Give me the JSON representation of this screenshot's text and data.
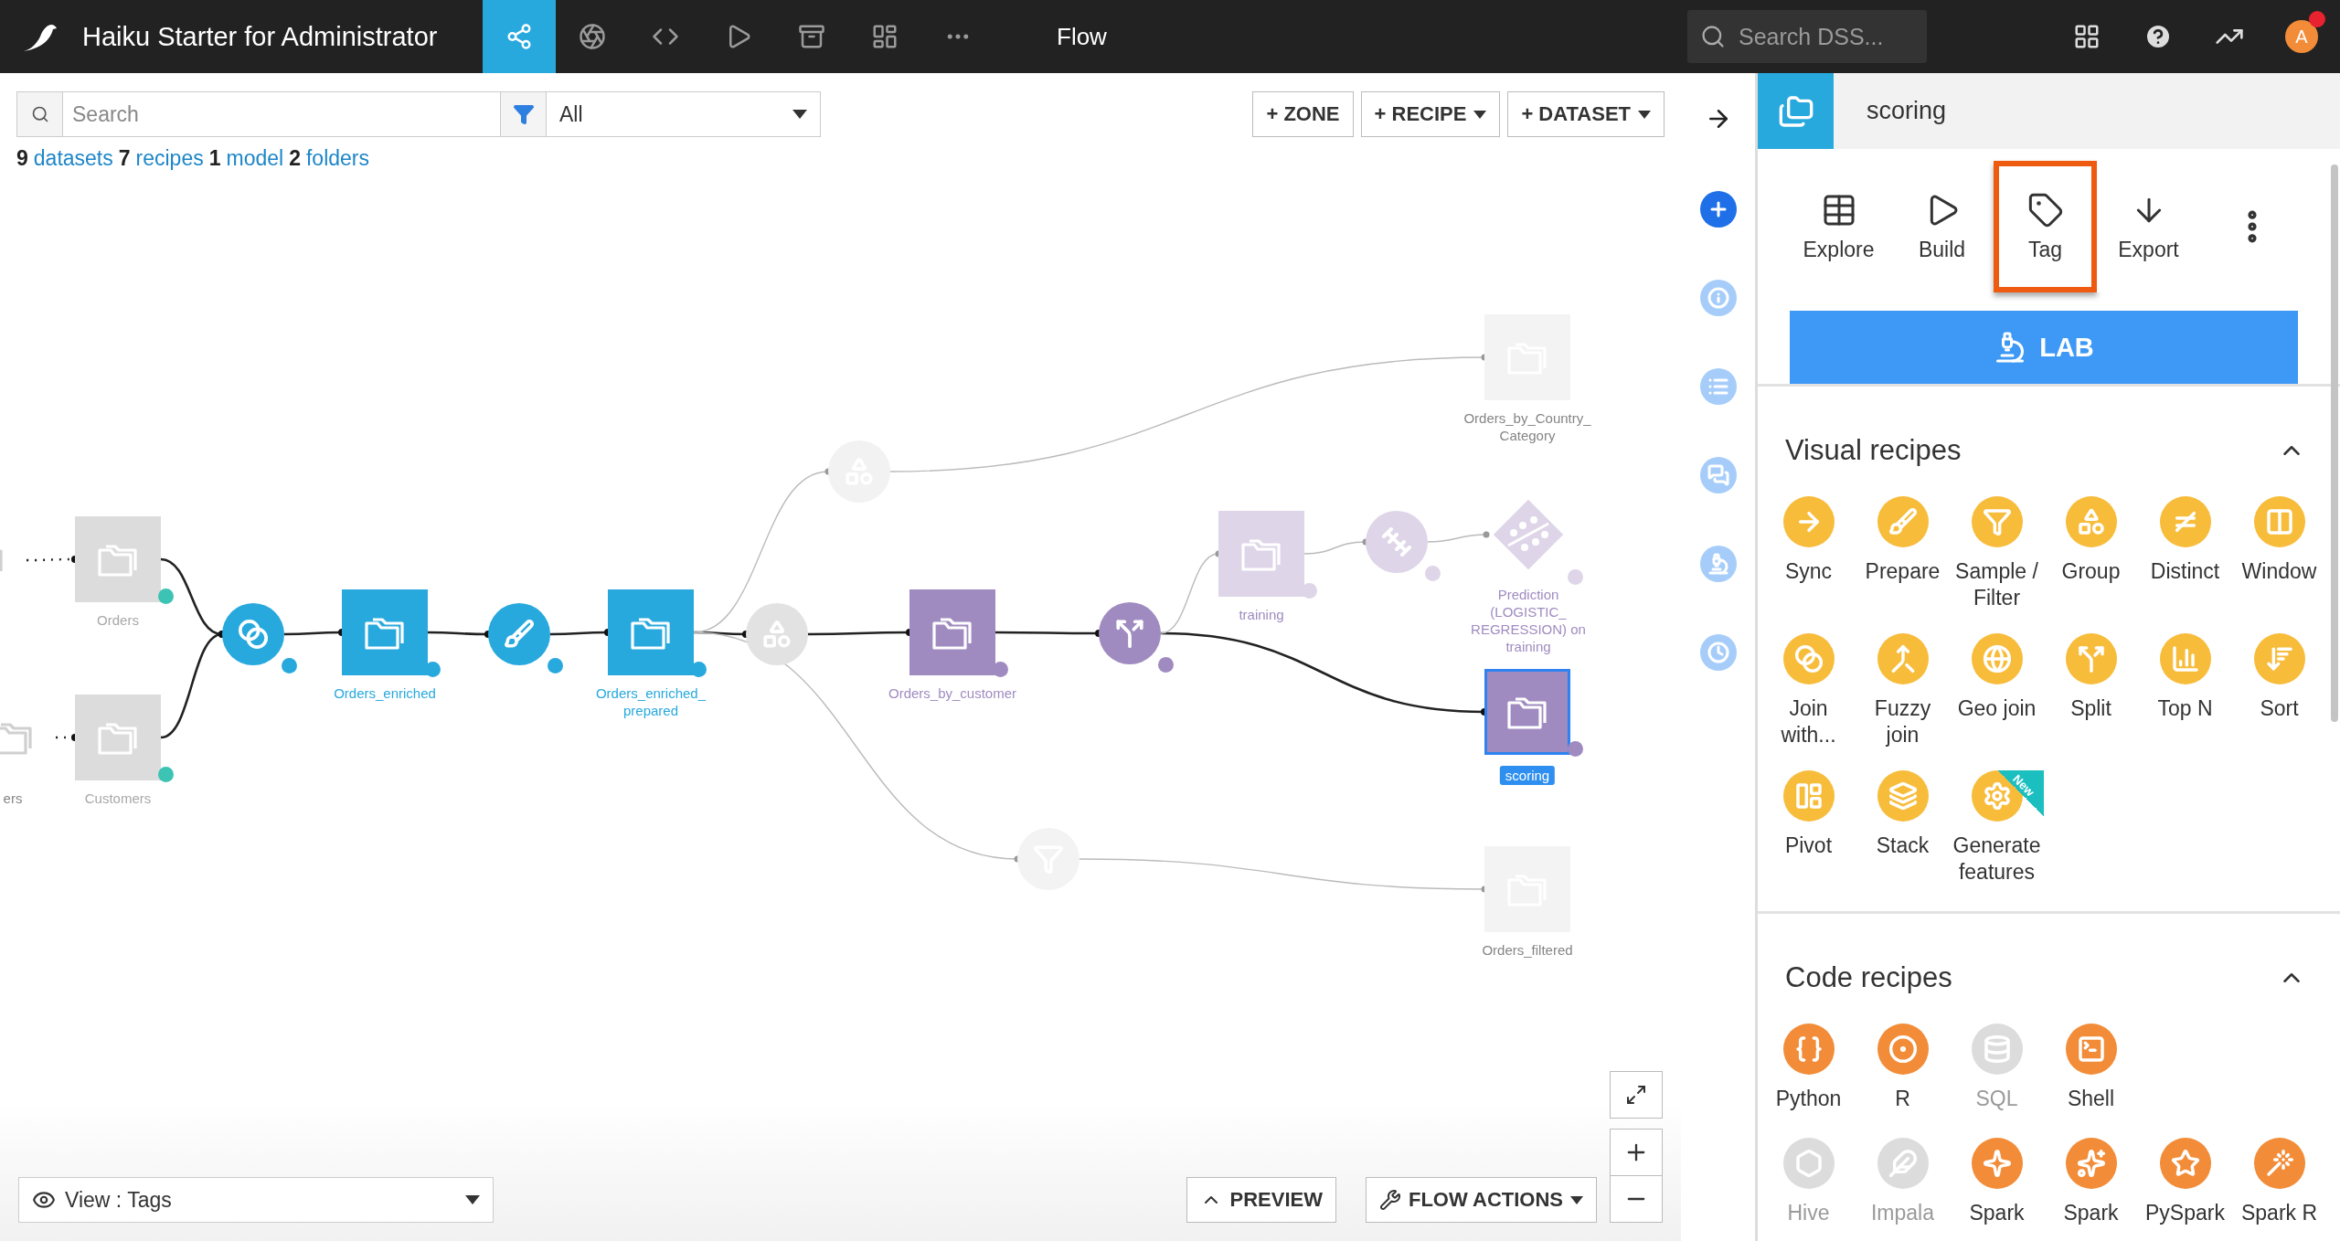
{
  "header": {
    "title": "Haiku Starter for Administrator",
    "nav": [
      {
        "selected": true
      },
      {
        "selected": false
      },
      {
        "selected": false
      },
      {
        "selected": false
      },
      {
        "selected": false
      },
      {
        "selected": false
      },
      {
        "selected": false
      }
    ],
    "section": "Flow",
    "search": {
      "placeholder": "Search DSS..."
    },
    "avatar": {
      "initial": "A",
      "notification": true
    }
  },
  "toolbar": {
    "search": {
      "placeholder": "Search"
    },
    "filter": {
      "value": "All"
    },
    "buttons": [
      {
        "label": "+ ZONE",
        "dropdown": false
      },
      {
        "label": "+ RECIPE",
        "dropdown": true
      },
      {
        "label": "+ DATASET",
        "dropdown": true
      }
    ]
  },
  "summary": [
    {
      "count": "9",
      "label": "datasets"
    },
    {
      "count": "7",
      "label": "recipes"
    },
    {
      "count": "1",
      "label": "model"
    },
    {
      "count": "2",
      "label": "folders"
    }
  ],
  "flow": {
    "nodes": [
      {
        "kind": "dataset",
        "color": "#ffffff",
        "dot": false,
        "selected": false
      },
      {
        "kind": "dataset",
        "label": "ers",
        "color": "#ffffff",
        "dot": false,
        "selected": false
      },
      {
        "kind": "dataset",
        "label": "Orders",
        "color": "#dcdcdc",
        "dot": true,
        "selected": false
      },
      {
        "kind": "dataset",
        "label": "Customers",
        "color": "#dcdcdc",
        "dot": true,
        "selected": false
      },
      {
        "kind": "join",
        "color": "#28a9dd",
        "dot": true,
        "selected": false
      },
      {
        "kind": "dataset",
        "label": "Orders_enriched",
        "color": "#28a9dd",
        "dot": true,
        "selected": false
      },
      {
        "kind": "prepare",
        "color": "#28a9dd",
        "dot": true,
        "selected": false
      },
      {
        "kind": "dataset",
        "label": "Orders_enriched_prepared",
        "color": "#28a9dd",
        "dot": true,
        "selected": false
      },
      {
        "kind": "group",
        "color": "#e2e2e2",
        "dot": false,
        "selected": false
      },
      {
        "kind": "group",
        "color": "#f2f2f2",
        "dot": false,
        "selected": false
      },
      {
        "kind": "dataset",
        "label": "Orders_by_customer",
        "color": "#a08bc0",
        "dot": true,
        "selected": false
      },
      {
        "kind": "split",
        "color": "#a08bc0",
        "dot": true,
        "selected": false
      },
      {
        "kind": "dataset",
        "label": "training",
        "color": "#ded5e8",
        "dot": true,
        "selected": false
      },
      {
        "kind": "train",
        "color": "#ded5e8",
        "dot": true,
        "selected": false
      },
      {
        "kind": "dataset",
        "label": "Orders_by_Country_Category",
        "color": "#f3f3f3",
        "dot": false,
        "selected": false
      },
      {
        "kind": "model",
        "label": "Prediction (LOGISTIC_REGRESSION) on training",
        "color": "#ded5e8",
        "dot": true,
        "selected": false
      },
      {
        "kind": "dataset",
        "label": "scoring",
        "color": "#a08bc0",
        "dot": true,
        "selected": true
      },
      {
        "kind": "filter",
        "color": "#f3f3f3",
        "dot": false,
        "selected": false
      },
      {
        "kind": "dataset",
        "label": "Orders_filtered",
        "color": "#f3f3f3",
        "dot": false,
        "selected": false
      }
    ]
  },
  "bottom": {
    "view": {
      "value": "View : Tags"
    },
    "buttons": [
      {
        "label": "PREVIEW",
        "kind": "preview"
      },
      {
        "label": "FLOW ACTIONS",
        "kind": "actions"
      }
    ]
  },
  "rail": [
    {
      "active": true
    },
    {
      "active": false
    },
    {
      "active": false
    },
    {
      "active": false
    },
    {
      "active": false
    },
    {
      "active": false
    }
  ],
  "panel": {
    "title": "scoring",
    "actions": [
      {
        "label": "Explore",
        "highlighted": false
      },
      {
        "label": "Build",
        "highlighted": false
      },
      {
        "label": "Tag",
        "highlighted": true
      },
      {
        "label": "Export",
        "highlighted": false
      }
    ],
    "lab": {
      "label": "LAB"
    },
    "sections": [
      {
        "title": "Visual recipes",
        "expanded": true,
        "color": "#f8bc3b",
        "groups": [
          [
            {
              "label": "Sync"
            },
            {
              "label": "Prepare"
            },
            {
              "label": "Sample / Filter"
            },
            {
              "label": "Group"
            },
            {
              "label": "Distinct"
            },
            {
              "label": "Window"
            },
            {
              "label": "Join with..."
            },
            {
              "label": "Fuzzy join"
            },
            {
              "label": "Geo join"
            },
            {
              "label": "Split"
            },
            {
              "label": "Top N"
            },
            {
              "label": "Sort"
            },
            {
              "label": "Pivot"
            },
            {
              "label": "Stack"
            },
            {
              "label": "Generate features",
              "badge": "New"
            }
          ]
        ]
      },
      {
        "title": "Code recipes",
        "expanded": true,
        "color": "#f28c38",
        "groups": [
          [
            {
              "label": "Python",
              "disabled": false
            },
            {
              "label": "R",
              "disabled": false
            },
            {
              "label": "SQL",
              "disabled": true
            },
            {
              "label": "Shell",
              "disabled": false
            }
          ],
          [
            {
              "label": "Hive",
              "disabled": true
            },
            {
              "label": "Impala",
              "disabled": true
            },
            {
              "label": "Spark",
              "disabled": false
            },
            {
              "label": "Spark",
              "disabled": false
            },
            {
              "label": "PySpark",
              "disabled": false
            },
            {
              "label": "Spark R",
              "disabled": false
            }
          ]
        ]
      }
    ]
  }
}
